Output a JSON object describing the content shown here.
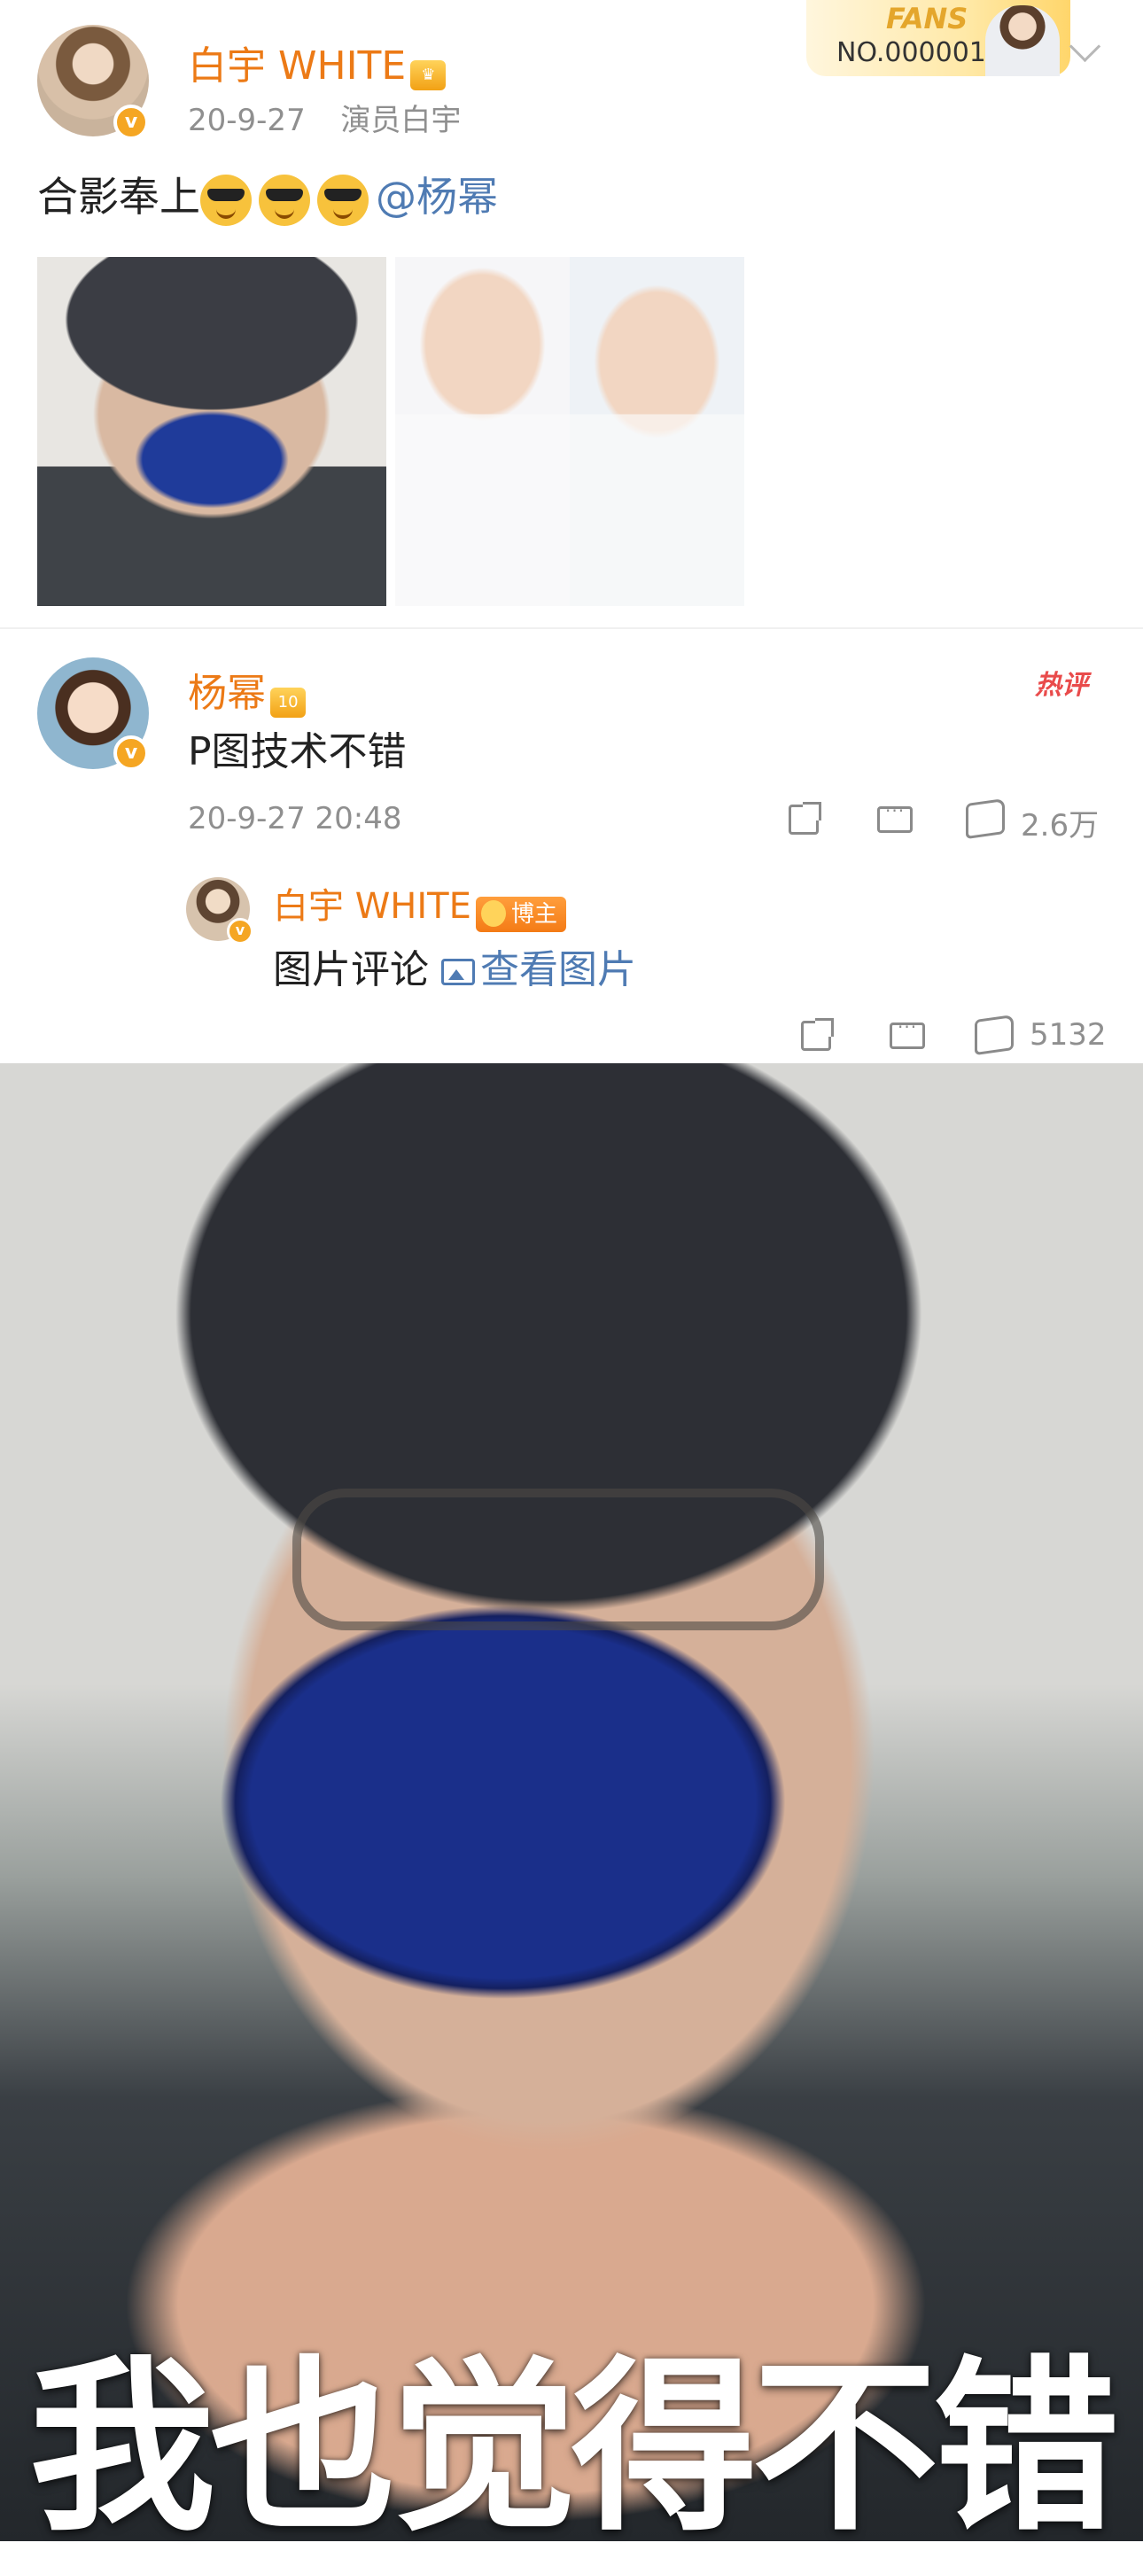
{
  "post": {
    "author": "白宇 WHITE",
    "date": "20-9-27",
    "source": "演员白宇",
    "text": "合影奉上",
    "mention": "@杨幂",
    "emoji_count": 3
  },
  "fans_badge": {
    "title": "FANS",
    "number": "NO.000001"
  },
  "comments": [
    {
      "author": "杨幂",
      "text": "P图技术不错",
      "time": "20-9-27 20:48",
      "hot_label": "热评",
      "likes": "2.6万",
      "level": "10"
    },
    {
      "author": "白宇 WHITE",
      "badge": "博主",
      "prefix": "图片评论",
      "link": "查看图片",
      "likes": "5132"
    }
  ],
  "meme": {
    "caption": "我也觉得不错"
  },
  "icons": {
    "verified": "verified-v-icon",
    "share": "share-icon",
    "comment": "comment-icon",
    "like": "like-icon",
    "expand": "chevron-down-icon"
  },
  "colors": {
    "username": "#ec7a16",
    "link": "#4f7bb3",
    "meta": "#8f8f8f",
    "hot": "#e94b4b",
    "verified": "#f5a623"
  }
}
